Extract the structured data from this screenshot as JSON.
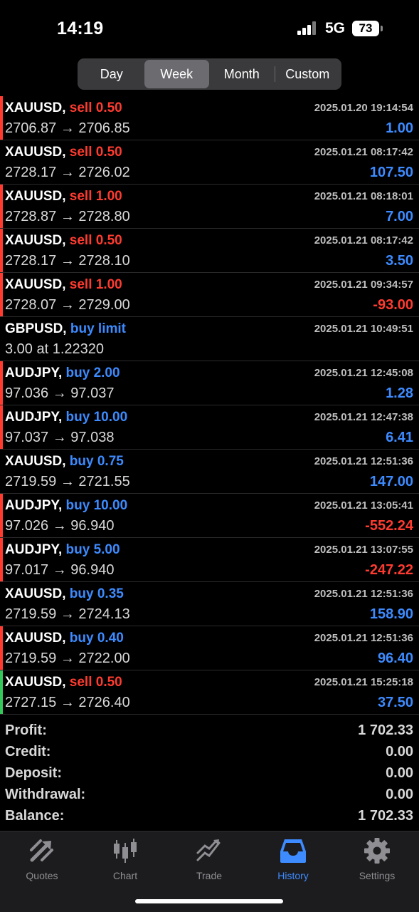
{
  "status": {
    "time": "14:19",
    "network": "5G",
    "battery": "73"
  },
  "period_tabs": [
    {
      "label": "Day",
      "active": false
    },
    {
      "label": "Week",
      "active": true
    },
    {
      "label": "Month",
      "active": false
    },
    {
      "label": "Custom",
      "active": false
    }
  ],
  "deals": [
    {
      "symbol": "XAUUSD,",
      "action": "sell 0.50",
      "action_color": "red",
      "prices": "2706.87 → 2706.85",
      "datetime": "2025.01.20 19:14:54",
      "result": "1.00",
      "result_color": "blue",
      "bar_color": "#ff3b30"
    },
    {
      "symbol": "XAUUSD,",
      "action": "sell 0.50",
      "action_color": "red",
      "prices": "2728.17 → 2726.02",
      "datetime": "2025.01.21 08:17:42",
      "result": "107.50",
      "result_color": "blue",
      "bar_color": ""
    },
    {
      "symbol": "XAUUSD,",
      "action": "sell 1.00",
      "action_color": "red",
      "prices": "2728.87 → 2728.80",
      "datetime": "2025.01.21 08:18:01",
      "result": "7.00",
      "result_color": "blue",
      "bar_color": "#ff3b30"
    },
    {
      "symbol": "XAUUSD,",
      "action": "sell 0.50",
      "action_color": "red",
      "prices": "2728.17 → 2728.10",
      "datetime": "2025.01.21 08:17:42",
      "result": "3.50",
      "result_color": "blue",
      "bar_color": "#ff3b30"
    },
    {
      "symbol": "XAUUSD,",
      "action": "sell 1.00",
      "action_color": "red",
      "prices": "2728.07 → 2729.00",
      "datetime": "2025.01.21 09:34:57",
      "result": "-93.00",
      "result_color": "red",
      "bar_color": "#ff3b30"
    },
    {
      "symbol": "GBPUSD,",
      "action": "buy limit",
      "action_color": "blue",
      "prices": "3.00 at 1.22320",
      "datetime": "2025.01.21 10:49:51",
      "result": "",
      "result_color": "blue",
      "bar_color": ""
    },
    {
      "symbol": "AUDJPY,",
      "action": "buy 2.00",
      "action_color": "blue",
      "prices": "97.036 → 97.037",
      "datetime": "2025.01.21 12:45:08",
      "result": "1.28",
      "result_color": "blue",
      "bar_color": "#ff3b30"
    },
    {
      "symbol": "AUDJPY,",
      "action": "buy 10.00",
      "action_color": "blue",
      "prices": "97.037 → 97.038",
      "datetime": "2025.01.21 12:47:38",
      "result": "6.41",
      "result_color": "blue",
      "bar_color": "#ff3b30"
    },
    {
      "symbol": "XAUUSD,",
      "action": "buy 0.75",
      "action_color": "blue",
      "prices": "2719.59 → 2721.55",
      "datetime": "2025.01.21 12:51:36",
      "result": "147.00",
      "result_color": "blue",
      "bar_color": ""
    },
    {
      "symbol": "AUDJPY,",
      "action": "buy 10.00",
      "action_color": "blue",
      "prices": "97.026 → 96.940",
      "datetime": "2025.01.21 13:05:41",
      "result": "-552.24",
      "result_color": "red",
      "bar_color": "#ff3b30"
    },
    {
      "symbol": "AUDJPY,",
      "action": "buy 5.00",
      "action_color": "blue",
      "prices": "97.017 → 96.940",
      "datetime": "2025.01.21 13:07:55",
      "result": "-247.22",
      "result_color": "red",
      "bar_color": "#ff3b30"
    },
    {
      "symbol": "XAUUSD,",
      "action": "buy 0.35",
      "action_color": "blue",
      "prices": "2719.59 → 2724.13",
      "datetime": "2025.01.21 12:51:36",
      "result": "158.90",
      "result_color": "blue",
      "bar_color": ""
    },
    {
      "symbol": "XAUUSD,",
      "action": "buy 0.40",
      "action_color": "blue",
      "prices": "2719.59 → 2722.00",
      "datetime": "2025.01.21 12:51:36",
      "result": "96.40",
      "result_color": "blue",
      "bar_color": "#ff3b30"
    },
    {
      "symbol": "XAUUSD,",
      "action": "sell 0.50",
      "action_color": "red",
      "prices": "2727.15 → 2726.40",
      "datetime": "2025.01.21 15:25:18",
      "result": "37.50",
      "result_color": "blue",
      "bar_color": "#34c759"
    }
  ],
  "summary": [
    {
      "label": "Profit:",
      "value": "1 702.33"
    },
    {
      "label": "Credit:",
      "value": "0.00"
    },
    {
      "label": "Deposit:",
      "value": "0.00"
    },
    {
      "label": "Withdrawal:",
      "value": "0.00"
    },
    {
      "label": "Balance:",
      "value": "1 702.33"
    }
  ],
  "tabbar": [
    {
      "label": "Quotes",
      "icon": "quotes-icon",
      "active": false
    },
    {
      "label": "Chart",
      "icon": "chart-icon",
      "active": false
    },
    {
      "label": "Trade",
      "icon": "trade-icon",
      "active": false
    },
    {
      "label": "History",
      "icon": "history-icon",
      "active": true
    },
    {
      "label": "Settings",
      "icon": "settings-icon",
      "active": false
    }
  ],
  "colors": {
    "sell": "#ff3b30",
    "buy": "#3d8bff",
    "accent": "#3d8bff",
    "loss_bar": "#ff3b30",
    "profit_bar": "#34c759"
  }
}
